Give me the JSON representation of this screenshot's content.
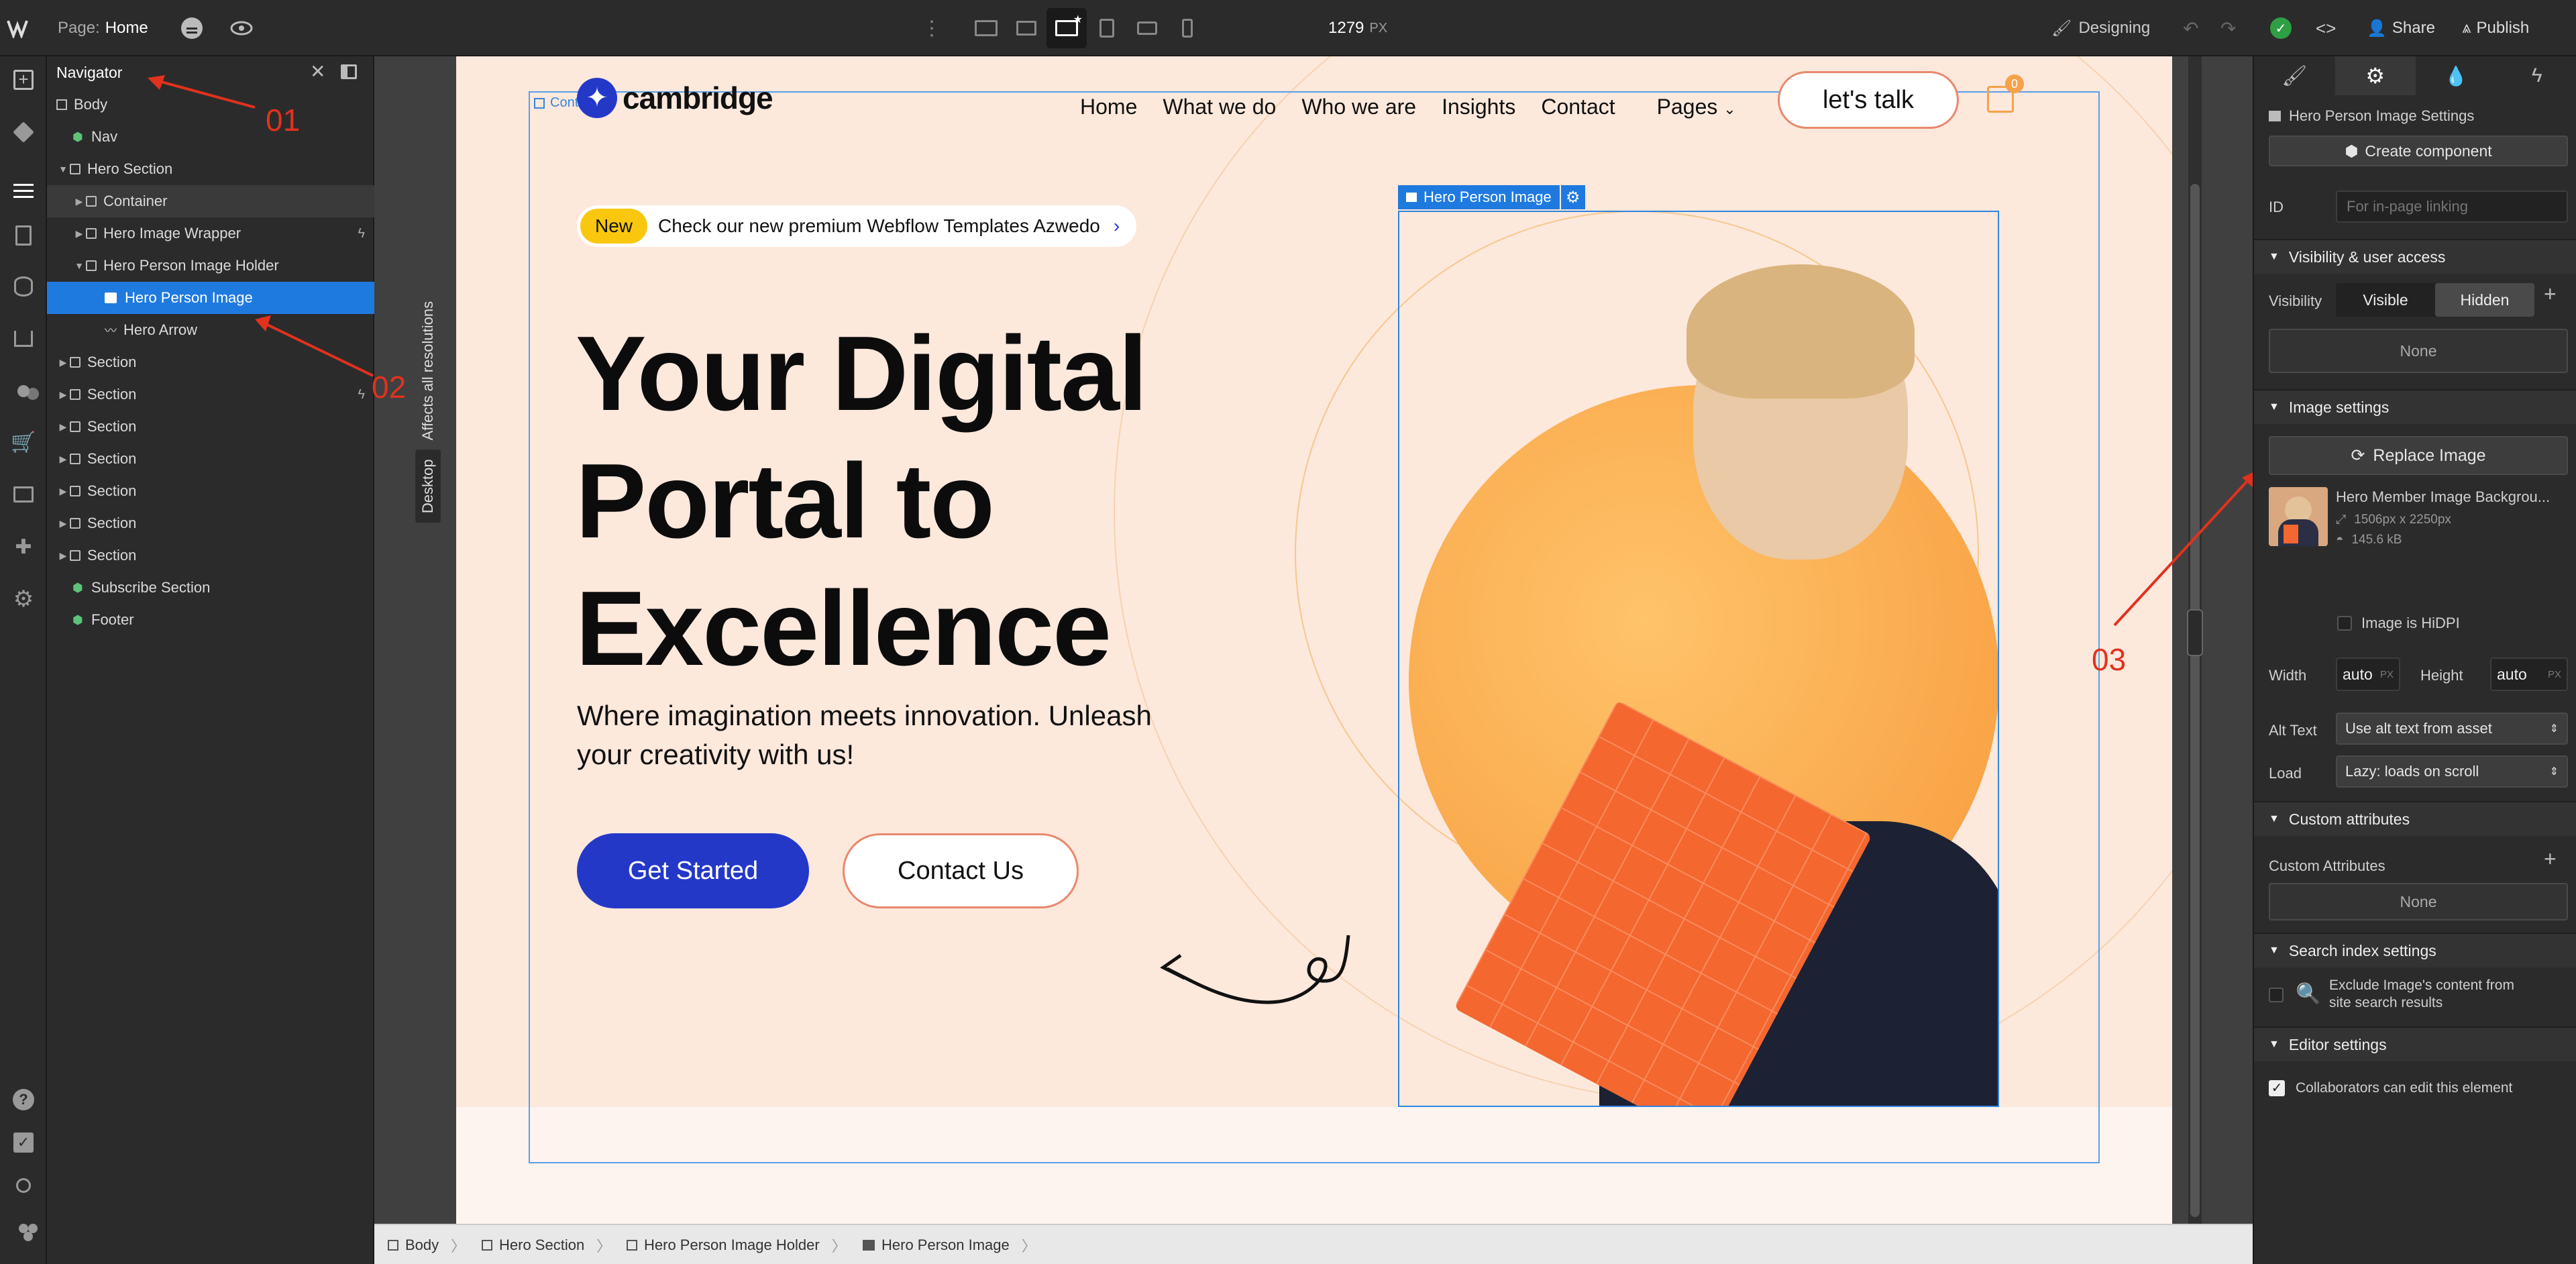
{
  "topbar": {
    "page_label": "Page:",
    "page_name": "Home",
    "width_value": "1279",
    "width_unit": "PX",
    "mode": "Designing",
    "share": "Share",
    "publish": "Publish"
  },
  "navigator": {
    "title": "Navigator",
    "items": [
      {
        "label": "Body"
      },
      {
        "label": "Nav"
      },
      {
        "label": "Hero Section"
      },
      {
        "label": "Container"
      },
      {
        "label": "Hero Image Wrapper"
      },
      {
        "label": "Hero Person Image Holder"
      },
      {
        "label": "Hero Person Image"
      },
      {
        "label": "Hero Arrow"
      },
      {
        "label": "Section"
      },
      {
        "label": "Section"
      },
      {
        "label": "Section"
      },
      {
        "label": "Section"
      },
      {
        "label": "Section"
      },
      {
        "label": "Section"
      },
      {
        "label": "Section"
      },
      {
        "label": "Subscribe Section"
      },
      {
        "label": "Footer"
      }
    ]
  },
  "canvas": {
    "side_label_1": "Affects all resolutions",
    "side_label_2": "Desktop",
    "container_tag": "Container",
    "selected_tag": "Hero Person Image"
  },
  "site": {
    "logo": "cambridge",
    "nav_links": [
      "Home",
      "What we do",
      "Who we are",
      "Insights",
      "Contact",
      "Pages"
    ],
    "talk_button": "let's talk",
    "cart_count": "0",
    "badge_new": "New",
    "badge_text": "Check our new premium Webflow Templates Azwedo",
    "headline_1": "Your Digital",
    "headline_2": "Portal to",
    "headline_3": "Excellence",
    "subtext_1": "Where imagination meets innovation. Unleash",
    "subtext_2": "your creativity with us!",
    "cta_primary": "Get Started",
    "cta_secondary": "Contact Us"
  },
  "panel": {
    "settings_title": "Hero Person Image Settings",
    "create_component": "Create component",
    "id_label": "ID",
    "id_placeholder": "For in-page linking",
    "visibility_section": "Visibility & user access",
    "visibility_label": "Visibility",
    "visible": "Visible",
    "hidden": "Hidden",
    "none_1": "None",
    "image_section": "Image settings",
    "replace_image": "Replace Image",
    "asset_name": "Hero Member Image Backgrou...",
    "asset_dims": "1506px x 2250px",
    "asset_size": "145.6 kB",
    "hidpi": "Image is HiDPI",
    "width_label": "Width",
    "width_value": "auto",
    "height_label": "Height",
    "height_value": "auto",
    "unit": "PX",
    "alt_label": "Alt Text",
    "alt_value": "Use alt text from asset",
    "load_label": "Load",
    "load_value": "Lazy: loads on scroll",
    "custom_section": "Custom attributes",
    "custom_label": "Custom Attributes",
    "none_2": "None",
    "search_section": "Search index settings",
    "exclude_1": "Exclude Image's content from",
    "exclude_2": "site search results",
    "editor_section": "Editor settings",
    "collaborators": "Collaborators can edit this element"
  },
  "breadcrumbs": [
    "Body",
    "Hero Section",
    "Hero Person Image Holder",
    "Hero Person Image"
  ],
  "annotations": [
    "01",
    "02",
    "03"
  ],
  "colors": {
    "accent": "#1f7ae0",
    "cta": "#2438c8",
    "annot": "#e1321e",
    "orange": "#f7a24a"
  }
}
